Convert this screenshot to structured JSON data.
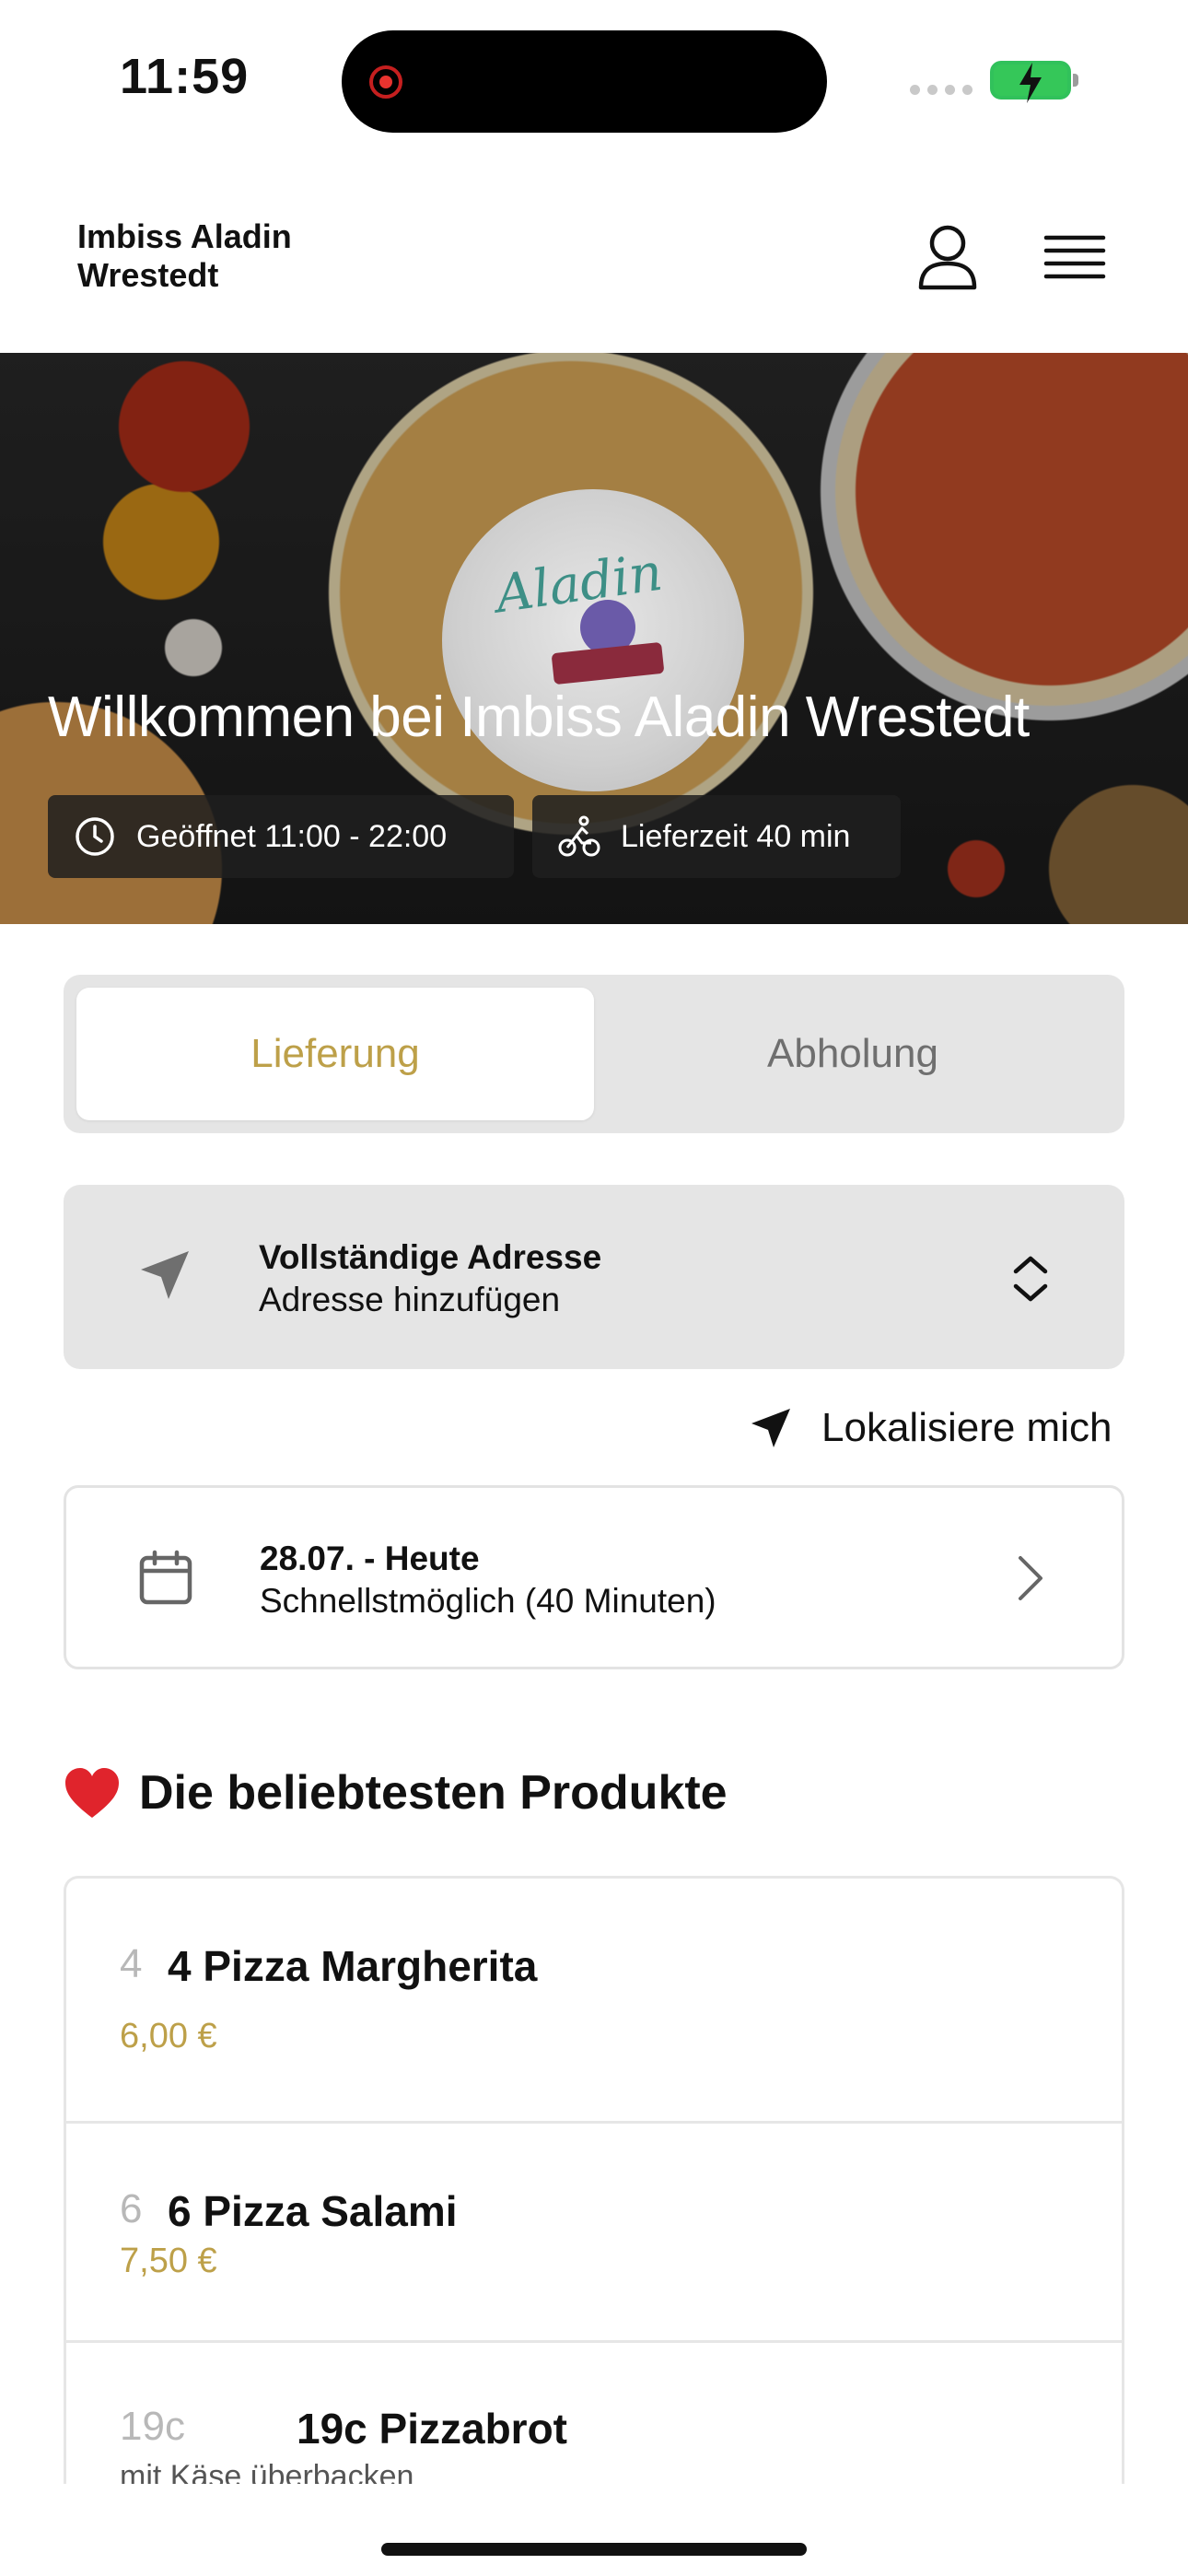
{
  "status_bar": {
    "time": "11:59"
  },
  "header": {
    "restaurant_name_line1": "Imbiss Aladin",
    "restaurant_name_line2": "Wrestedt"
  },
  "hero": {
    "logo_text": "Aladin",
    "welcome": "Willkommen bei Imbiss Aladin Wrestedt",
    "opening_hours": "Geöffnet 11:00 - 22:00",
    "delivery_time": "Lieferzeit 40 min"
  },
  "order_mode": {
    "delivery": "Lieferung",
    "pickup": "Abholung",
    "selected": "Lieferung"
  },
  "address": {
    "title": "Vollständige Adresse",
    "subtitle": "Adresse hinzufügen"
  },
  "locate": {
    "label": "Lokalisiere mich"
  },
  "schedule": {
    "date": "28.07. - Heute",
    "time": "Schnellstmöglich (40 Minuten)"
  },
  "popular": {
    "title": "Die beliebtesten Produkte",
    "items": [
      {
        "number": "4",
        "name": "4 Pizza Margherita",
        "price": "6,00 €"
      },
      {
        "number": "6",
        "name": "6 Pizza Salami",
        "price": "7,50 €"
      },
      {
        "number": "19c",
        "name": "19c Pizzabrot",
        "description": "mit Käse überbacken"
      }
    ]
  },
  "colors": {
    "accent": "#bda049",
    "panel": "#e5e5e5",
    "battery": "#35c759",
    "record": "#e8332f"
  }
}
